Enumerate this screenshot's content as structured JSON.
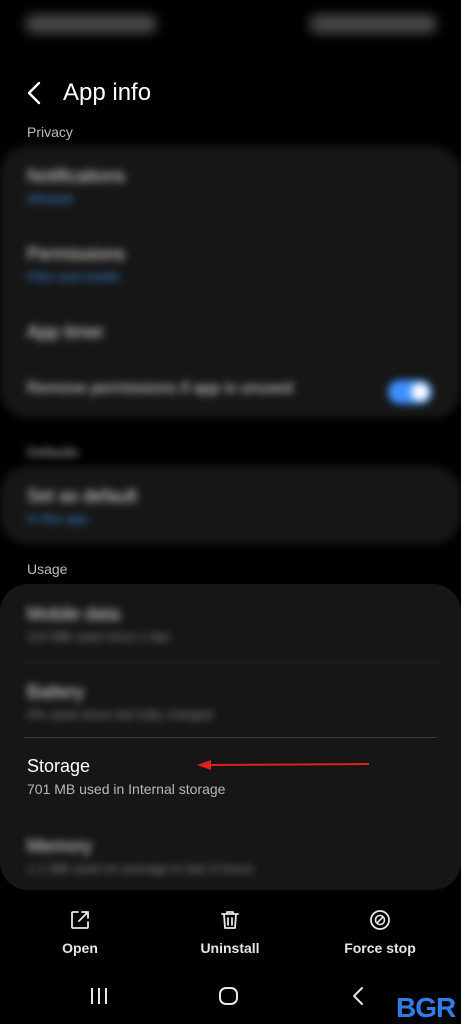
{
  "header": {
    "title": "App info"
  },
  "privacy": {
    "label": "Privacy",
    "items": [
      {
        "title": "Notifications",
        "sub": "Allowed"
      },
      {
        "title": "Permissions",
        "sub": "Files and media"
      },
      {
        "title": "App timer",
        "sub": ""
      },
      {
        "title": "Remove permissions if app is unused",
        "sub": "",
        "toggle": true
      }
    ]
  },
  "defaults": {
    "label": "Defaults",
    "items": [
      {
        "title": "Set as default",
        "sub": "In this app"
      }
    ]
  },
  "usage": {
    "label": "Usage",
    "items": [
      {
        "title": "Mobile data",
        "sub": "114 MB used since 1 Apr"
      },
      {
        "title": "Battery",
        "sub": "0% used since last fully charged"
      }
    ],
    "storage": {
      "title": "Storage",
      "sub": "701 MB used in Internal storage"
    },
    "memory": {
      "title": "Memory",
      "sub": "1.1 MB used on average in last 3 hours"
    }
  },
  "actions": {
    "open": "Open",
    "uninstall": "Uninstall",
    "force_stop": "Force stop"
  },
  "logo": "BGR",
  "colors": {
    "accent": "#3e91ff",
    "arrow": "#e0201b",
    "logo": "#2f7ee8"
  }
}
